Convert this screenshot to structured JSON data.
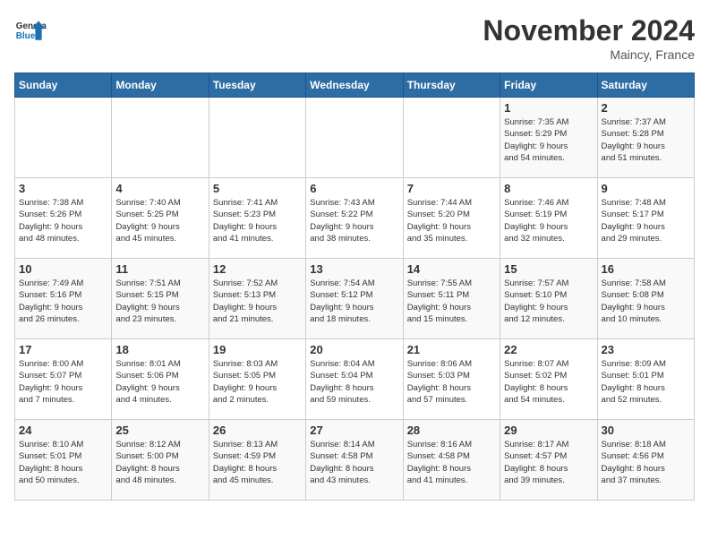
{
  "header": {
    "logo_general": "General",
    "logo_blue": "Blue",
    "month": "November 2024",
    "location": "Maincy, France"
  },
  "weekdays": [
    "Sunday",
    "Monday",
    "Tuesday",
    "Wednesday",
    "Thursday",
    "Friday",
    "Saturday"
  ],
  "weeks": [
    [
      {
        "day": "",
        "info": ""
      },
      {
        "day": "",
        "info": ""
      },
      {
        "day": "",
        "info": ""
      },
      {
        "day": "",
        "info": ""
      },
      {
        "day": "",
        "info": ""
      },
      {
        "day": "1",
        "info": "Sunrise: 7:35 AM\nSunset: 5:29 PM\nDaylight: 9 hours\nand 54 minutes."
      },
      {
        "day": "2",
        "info": "Sunrise: 7:37 AM\nSunset: 5:28 PM\nDaylight: 9 hours\nand 51 minutes."
      }
    ],
    [
      {
        "day": "3",
        "info": "Sunrise: 7:38 AM\nSunset: 5:26 PM\nDaylight: 9 hours\nand 48 minutes."
      },
      {
        "day": "4",
        "info": "Sunrise: 7:40 AM\nSunset: 5:25 PM\nDaylight: 9 hours\nand 45 minutes."
      },
      {
        "day": "5",
        "info": "Sunrise: 7:41 AM\nSunset: 5:23 PM\nDaylight: 9 hours\nand 41 minutes."
      },
      {
        "day": "6",
        "info": "Sunrise: 7:43 AM\nSunset: 5:22 PM\nDaylight: 9 hours\nand 38 minutes."
      },
      {
        "day": "7",
        "info": "Sunrise: 7:44 AM\nSunset: 5:20 PM\nDaylight: 9 hours\nand 35 minutes."
      },
      {
        "day": "8",
        "info": "Sunrise: 7:46 AM\nSunset: 5:19 PM\nDaylight: 9 hours\nand 32 minutes."
      },
      {
        "day": "9",
        "info": "Sunrise: 7:48 AM\nSunset: 5:17 PM\nDaylight: 9 hours\nand 29 minutes."
      }
    ],
    [
      {
        "day": "10",
        "info": "Sunrise: 7:49 AM\nSunset: 5:16 PM\nDaylight: 9 hours\nand 26 minutes."
      },
      {
        "day": "11",
        "info": "Sunrise: 7:51 AM\nSunset: 5:15 PM\nDaylight: 9 hours\nand 23 minutes."
      },
      {
        "day": "12",
        "info": "Sunrise: 7:52 AM\nSunset: 5:13 PM\nDaylight: 9 hours\nand 21 minutes."
      },
      {
        "day": "13",
        "info": "Sunrise: 7:54 AM\nSunset: 5:12 PM\nDaylight: 9 hours\nand 18 minutes."
      },
      {
        "day": "14",
        "info": "Sunrise: 7:55 AM\nSunset: 5:11 PM\nDaylight: 9 hours\nand 15 minutes."
      },
      {
        "day": "15",
        "info": "Sunrise: 7:57 AM\nSunset: 5:10 PM\nDaylight: 9 hours\nand 12 minutes."
      },
      {
        "day": "16",
        "info": "Sunrise: 7:58 AM\nSunset: 5:08 PM\nDaylight: 9 hours\nand 10 minutes."
      }
    ],
    [
      {
        "day": "17",
        "info": "Sunrise: 8:00 AM\nSunset: 5:07 PM\nDaylight: 9 hours\nand 7 minutes."
      },
      {
        "day": "18",
        "info": "Sunrise: 8:01 AM\nSunset: 5:06 PM\nDaylight: 9 hours\nand 4 minutes."
      },
      {
        "day": "19",
        "info": "Sunrise: 8:03 AM\nSunset: 5:05 PM\nDaylight: 9 hours\nand 2 minutes."
      },
      {
        "day": "20",
        "info": "Sunrise: 8:04 AM\nSunset: 5:04 PM\nDaylight: 8 hours\nand 59 minutes."
      },
      {
        "day": "21",
        "info": "Sunrise: 8:06 AM\nSunset: 5:03 PM\nDaylight: 8 hours\nand 57 minutes."
      },
      {
        "day": "22",
        "info": "Sunrise: 8:07 AM\nSunset: 5:02 PM\nDaylight: 8 hours\nand 54 minutes."
      },
      {
        "day": "23",
        "info": "Sunrise: 8:09 AM\nSunset: 5:01 PM\nDaylight: 8 hours\nand 52 minutes."
      }
    ],
    [
      {
        "day": "24",
        "info": "Sunrise: 8:10 AM\nSunset: 5:01 PM\nDaylight: 8 hours\nand 50 minutes."
      },
      {
        "day": "25",
        "info": "Sunrise: 8:12 AM\nSunset: 5:00 PM\nDaylight: 8 hours\nand 48 minutes."
      },
      {
        "day": "26",
        "info": "Sunrise: 8:13 AM\nSunset: 4:59 PM\nDaylight: 8 hours\nand 45 minutes."
      },
      {
        "day": "27",
        "info": "Sunrise: 8:14 AM\nSunset: 4:58 PM\nDaylight: 8 hours\nand 43 minutes."
      },
      {
        "day": "28",
        "info": "Sunrise: 8:16 AM\nSunset: 4:58 PM\nDaylight: 8 hours\nand 41 minutes."
      },
      {
        "day": "29",
        "info": "Sunrise: 8:17 AM\nSunset: 4:57 PM\nDaylight: 8 hours\nand 39 minutes."
      },
      {
        "day": "30",
        "info": "Sunrise: 8:18 AM\nSunset: 4:56 PM\nDaylight: 8 hours\nand 37 minutes."
      }
    ]
  ]
}
